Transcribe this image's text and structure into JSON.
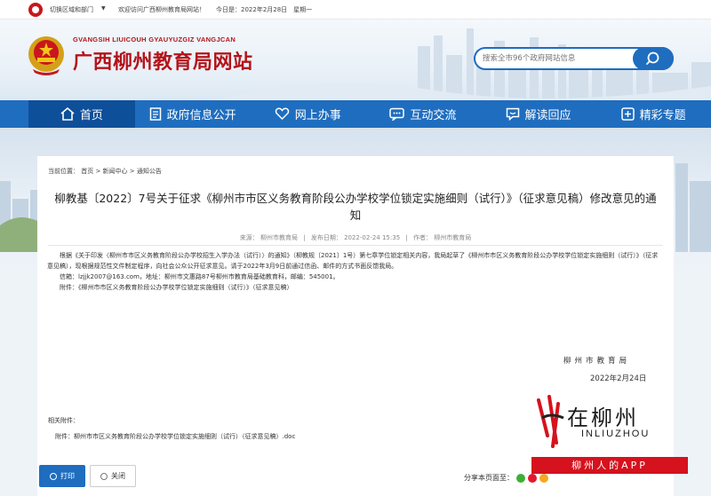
{
  "topbar": {
    "switch_label": "切换区域和部门",
    "welcome": "欢迎访问广西柳州教育局网站！",
    "today": "今日是：2022年2月28日　星期一"
  },
  "header": {
    "site_en": "GVANGSIH LIUICOUH GYAUYUZGIZ VANGJCAN",
    "site_zh": "广西柳州教育局网站",
    "search_placeholder": "搜索全市96个政府网站信息"
  },
  "nav": {
    "items": [
      {
        "label": "首页",
        "icon": "home-icon"
      },
      {
        "label": "政府信息公开",
        "icon": "document-icon"
      },
      {
        "label": "网上办事",
        "icon": "heart-hands-icon"
      },
      {
        "label": "互动交流",
        "icon": "chat-icon"
      },
      {
        "label": "解读回应",
        "icon": "comment-icon"
      },
      {
        "label": "精彩专题",
        "icon": "plus-square-icon"
      }
    ]
  },
  "article": {
    "breadcrumb": "当前位置： 首页 > 新闻中心 > 通知公告",
    "title": "柳教基〔2022〕7号关于征求《柳州市市区义务教育阶段公办学校学位锁定实施细则（试行）》（征求意见稿）修改意见的通知",
    "source": "来源： 柳州市教育局",
    "date": "发布日期： 2022-02-24 15:35",
    "author": "作者： 柳州市教育局",
    "para1": "根据《关于印发〈柳州市市区义务教育阶段公办学校招生入学办法（试行）〉的通知》（柳教规〔2021〕1号）第七章学位锁定相关内容，我局起草了《柳州市市区义务教育阶段公办学校学位锁定实施细则（试行）》（征求意见稿），现根据规范性文件制定程序，向社会公众公开征求意见。请于2022年3月9日前通过信函、邮件的方式书面反馈我局。",
    "para2": "信箱：lzjjk2007@163.com，地址：柳州市文惠路87号柳州市教育局基础教育科，邮编：545001。",
    "para3": "附件：《柳州市市区义务教育阶段公办学校学位锁定实施细则（试行）》（征求意见稿）",
    "sign_org": "柳州市教育局",
    "sign_date": "2022年2月24日",
    "attach_label": "相关附件：",
    "attach_item": "附件：柳州市市区义务教育阶段公办学校学位锁定实施细则（试行）（征求意见稿）.doc"
  },
  "actions": {
    "print": "打印",
    "close": "关闭",
    "share": "分享本页面至："
  },
  "watermark": {
    "zh": "在柳州",
    "en": "INLIUZHOU",
    "slogan": "柳州人的APP"
  },
  "colors": {
    "brand_blue": "#1f6dbf",
    "active_blue": "#0e4f9a",
    "brand_red": "#b3141a"
  }
}
